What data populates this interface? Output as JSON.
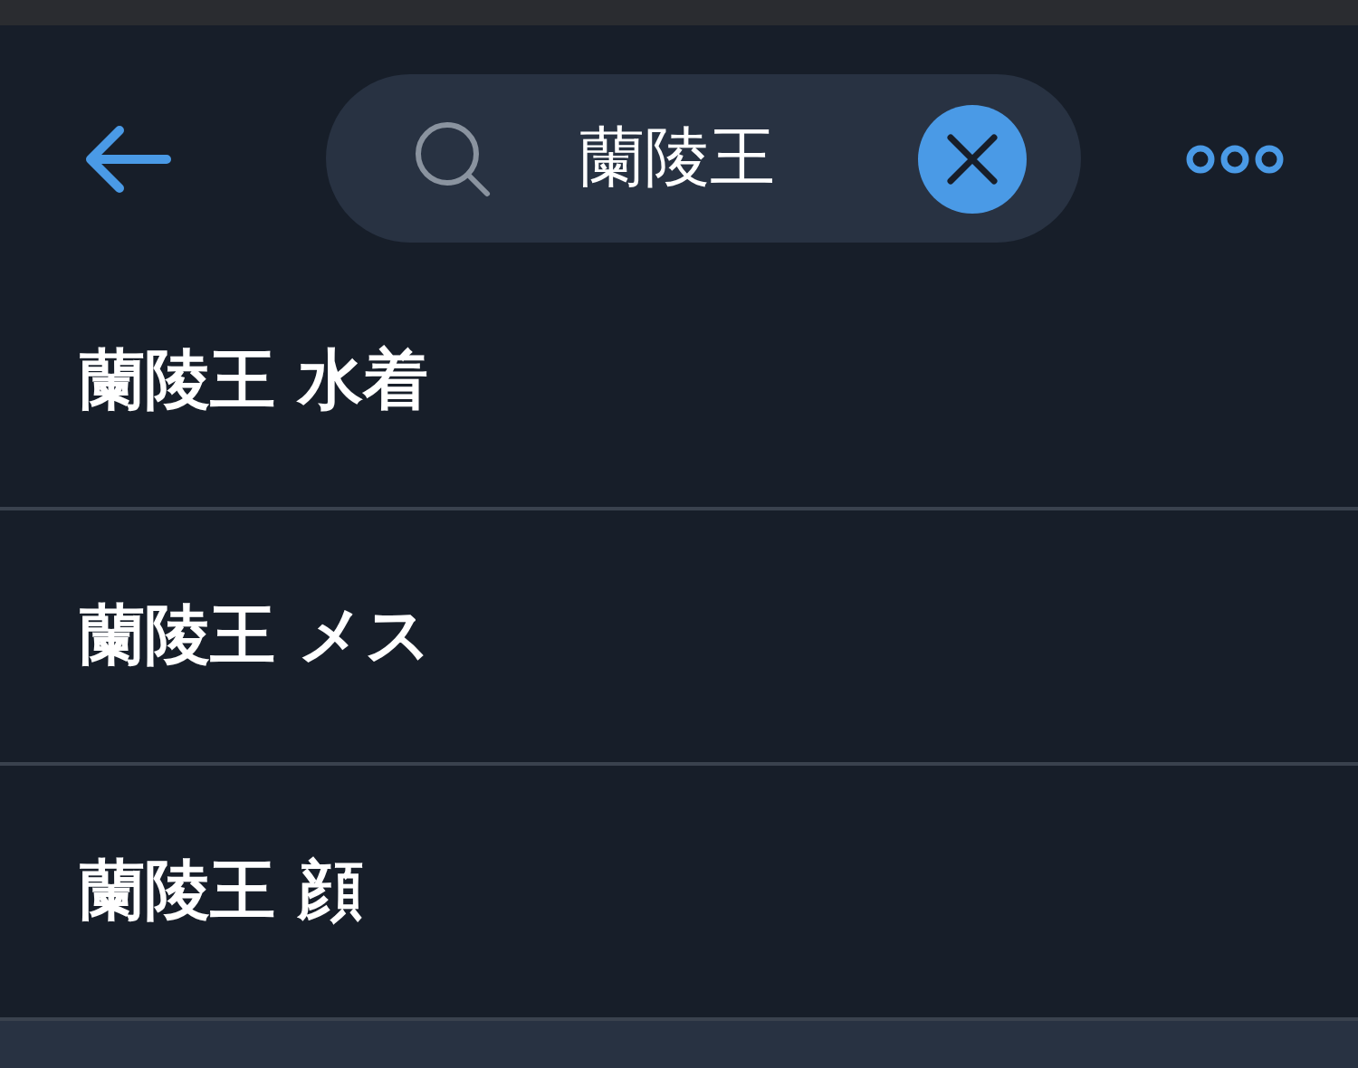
{
  "search": {
    "value": "蘭陵王"
  },
  "suggestions": [
    {
      "text": "蘭陵王 水着"
    },
    {
      "text": "蘭陵王 メス"
    },
    {
      "text": "蘭陵王 顔"
    }
  ]
}
